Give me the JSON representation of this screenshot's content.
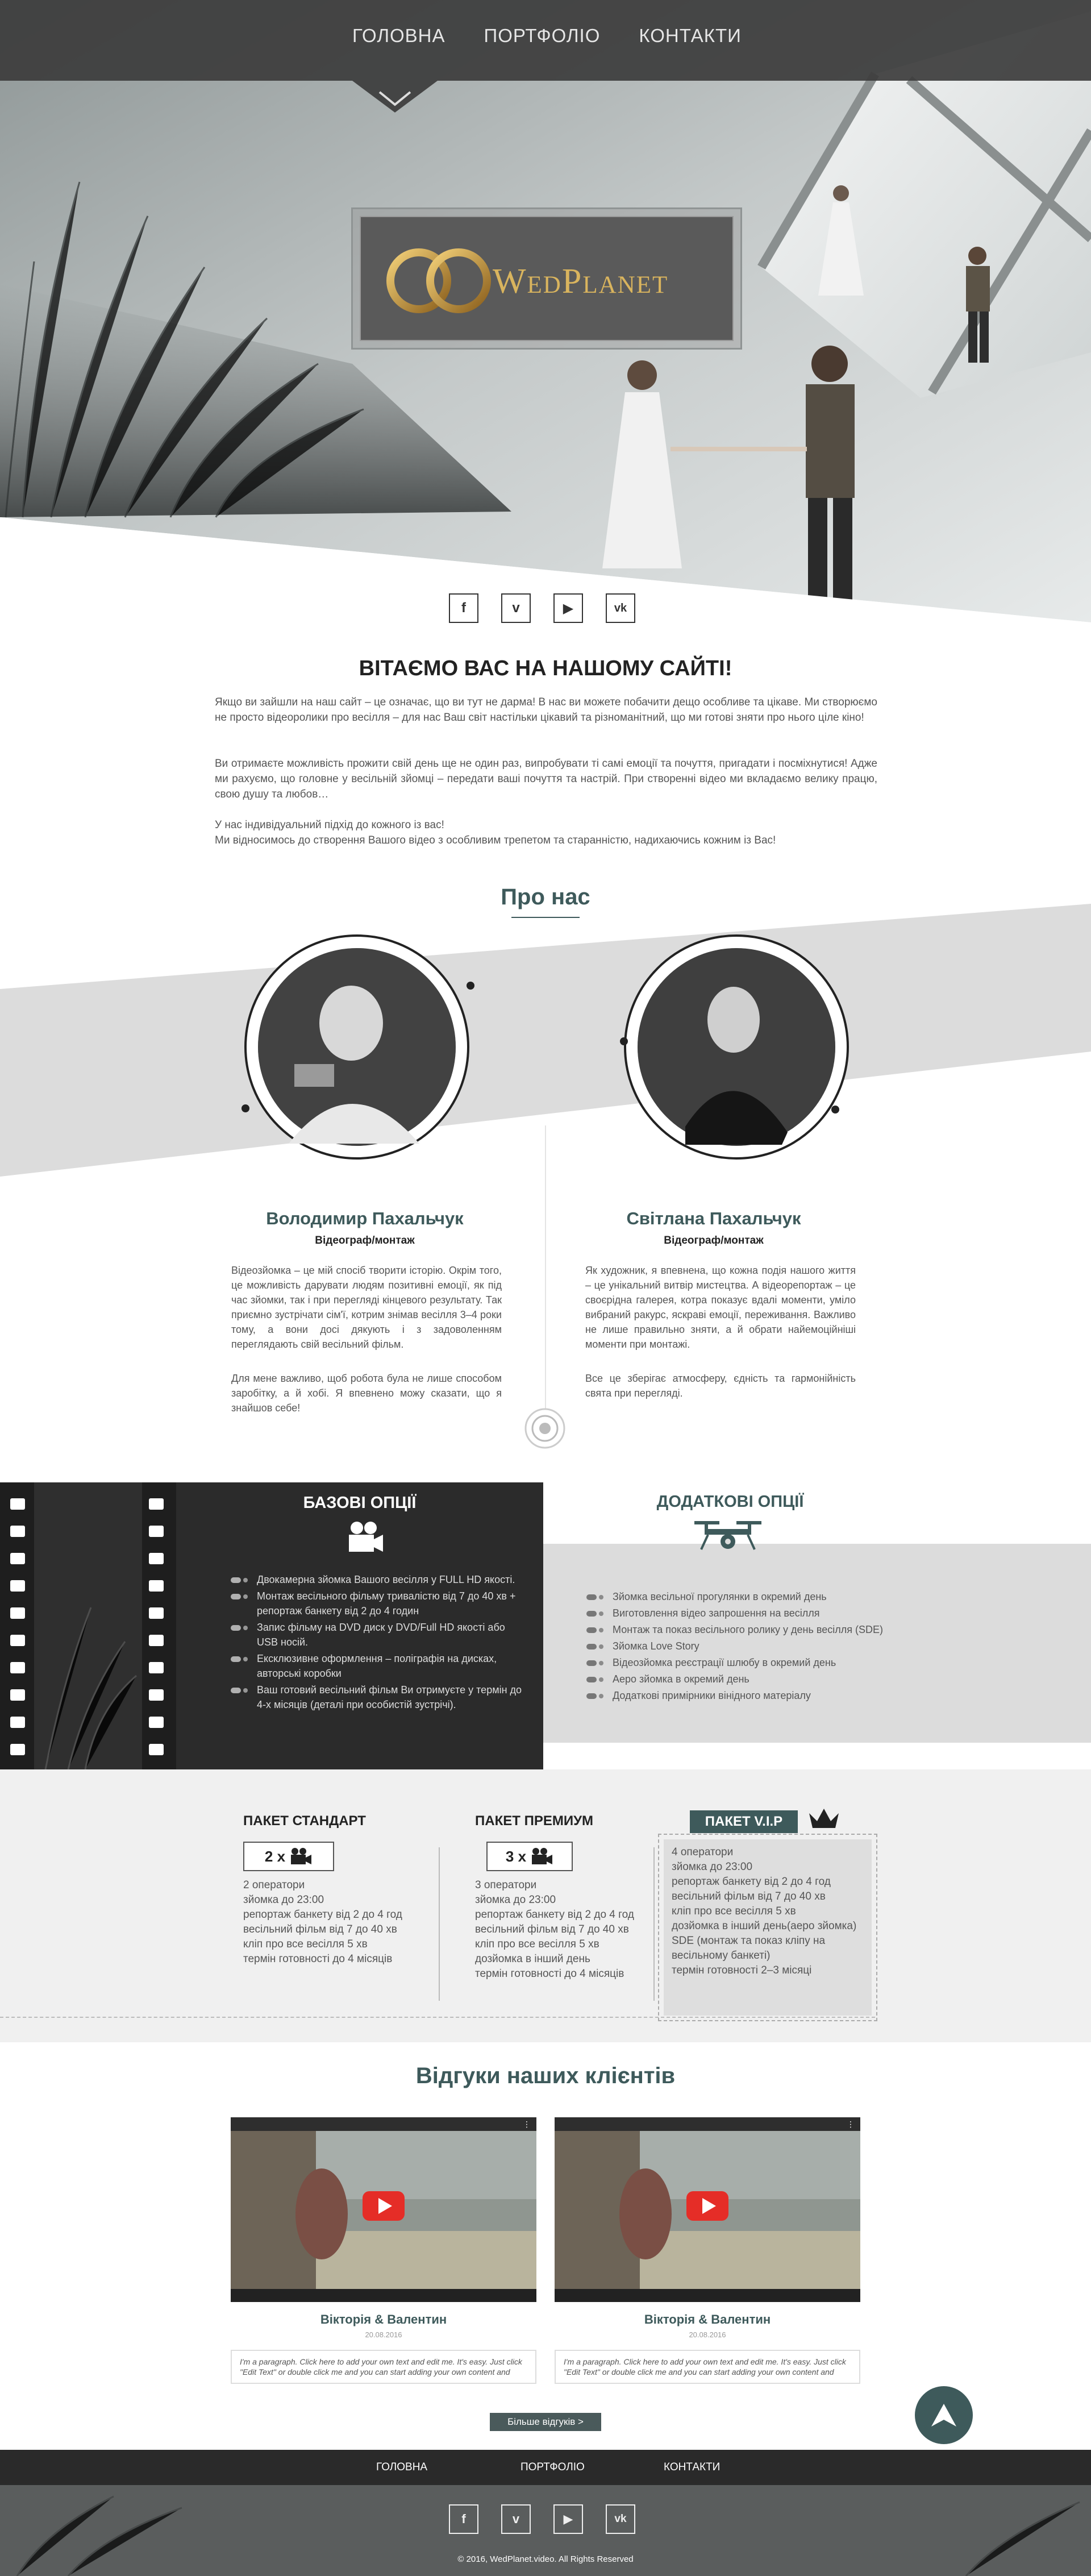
{
  "nav": {
    "items": [
      "ГОЛОВНА",
      "ПОРТФОЛІО",
      "КОНТАКТИ"
    ]
  },
  "brand": {
    "logo_text": "WedPlanet"
  },
  "social": [
    {
      "icon": "facebook-icon",
      "glyph": "f"
    },
    {
      "icon": "vimeo-icon",
      "glyph": "v"
    },
    {
      "icon": "youtube-icon",
      "glyph": "▶"
    },
    {
      "icon": "vk-icon",
      "glyph": "vk"
    }
  ],
  "welcome": {
    "title": "ВІТАЄМО ВАС НА НАШОМУ САЙТІ!",
    "p1": "Якщо ви зайшли на наш сайт – це означає, що ви тут не дарма! В нас ви можете побачити дещо особливе та цікаве. Ми створюємо не просто відеоролики про весілля – для нас Ваш світ настільки цікавий та різноманітний, що ми готові зняти про нього ціле кіно!",
    "p2": "Ви отримаєте можливість прожити свій день ще не один раз, випробувати ті самі емоції та почуття, пригадати і посміхнутися! Адже ми рахуємо, що головне у весільній зйомці – передати ваші почуття та настрій. При створенні відео ми вкладаємо велику працю, свою душу та любов…",
    "p3": "У нас індивідуальний підхід до кожного із вас!",
    "p4": "Ми відносимось до створення Вашого відео з особливим трепетом та старанністю, надихаючись кожним із Вас!"
  },
  "about": {
    "title": "Про нас",
    "members": [
      {
        "name": "Володимир Пахальчук",
        "role": "Відеограф/монтаж",
        "text": "Відеозйомка – це мій спосіб творити історію. Окрім того, це можливість дарувати людям позитивні емоції, як під час зйомки, так і при перегляді кінцевого результату. Так приємно зустрічати сім'ї, котрим знімав весілля 3–4 роки тому, а вони досі дякують і з задоволенням переглядають свій весільний фільм.",
        "text2": "Для мене важливо, щоб робота була не лише способом заробітку, а й хобі. Я впевнено можу сказати, що я знайшов себе!"
      },
      {
        "name": "Світлана Пахальчук",
        "role": "Відеограф/монтаж",
        "text": "Як художник, я впевнена, що кожна подія нашого життя – це унікальний витвір мистецтва. А відеорепортаж – це своєрідна галерея, котра показує вдалі моменти, уміло вибраний ракурс, яскраві емоції, переживання. Важливо не лише правильно зняти, а й обрати найемоційніші моменти при монтажі.",
        "text2": "Все це зберігає атмосферу, єдність та гармонійність свята при перегляді."
      }
    ]
  },
  "basic_options": {
    "title": "БАЗОВІ ОПЦІЇ",
    "items": [
      "Двокамерна зйомка Вашого весілля у FULL HD якості.",
      "Монтаж весільного фільму тривалістю від 7 до 40 хв + репортаж банкету від 2 до 4 годин",
      "Запис фільму на DVD диск у DVD/Full HD якості або USB носій.",
      "Ексклюзивне оформлення – поліграфія на дисках, авторські коробки",
      "Ваш готовий весільний фільм Ви отримуєте у термін до 4-х місяців (деталі при особистій зустрічі)."
    ]
  },
  "extra_options": {
    "title": "ДОДАТКОВІ ОПЦІЇ",
    "items": [
      "Зйомка весільної прогулянки в окремий день",
      "Виготовлення відео запрошення на весілля",
      "Монтаж та показ весільного ролику у день весілля (SDE)",
      "Зйомка Love Story",
      "Відеозйомка реєстрації шлюбу в окремий день",
      "Аеро зйомка в окремий день",
      "Додаткові примірники вінідного матеріалу"
    ]
  },
  "packages": [
    {
      "title": "ПАКЕТ СТАНДАРТ",
      "cameras": "2 x",
      "lines": [
        "2 оператори",
        "зйомка до 23:00",
        "репортаж банкету від 2 до 4 год",
        "весільний фільм від 7 до 40 хв",
        "кліп про все весілля 5 хв",
        "термін готовності до 4 місяців"
      ]
    },
    {
      "title": "ПАКЕТ ПРЕМИУМ",
      "cameras": "3 x",
      "lines": [
        "3 оператори",
        "зйомка до 23:00",
        "репортаж банкету від 2 до 4 год",
        "весільний фільм від 7 до 40 хв",
        "кліп про все весілля 5 хв",
        "дозйомка в інший день",
        "термін готовності до 4 місяців"
      ]
    },
    {
      "title": "ПАКЕТ V.I.P",
      "lines": [
        "4 оператори",
        "зйомка до 23:00",
        "репортаж банкету від 2 до 4 год",
        "весільний фільм від 7 до 40 хв",
        "кліп про все весілля 5 хв",
        "дозйомка в інший день(аеро зйомка)",
        "SDE (монтаж та показ кліпу на весільному банкеті)",
        "термін готовності 2–3 місяці"
      ]
    }
  ],
  "reviews": {
    "title": "Відгуки наших клієнтів",
    "items": [
      {
        "name": "Вікторія & Валентин",
        "date": "20.08.2016",
        "text": "I'm a paragraph. Click here to add your own text and edit me. It's easy. Just click \"Edit Text\" or double click me and you can start adding your own content and"
      },
      {
        "name": "Вікторія & Валентин",
        "date": "20.08.2016",
        "text": "I'm a paragraph. Click here to add your own text and edit me. It's easy. Just click \"Edit Text\" or double click me and you can start adding your own content and"
      }
    ],
    "more_label": "Більше відгуків  >"
  },
  "footer": {
    "links": [
      "ГОЛОВНА",
      "ПОРТФОЛІО",
      "КОНТАКТИ"
    ],
    "copyright": "© 2016, WedPlanet.video. All Rights Reserved"
  },
  "colors": {
    "accent": "#3e5a5b",
    "dark": "#2b2b2b",
    "gray": "#dcdcdc"
  }
}
